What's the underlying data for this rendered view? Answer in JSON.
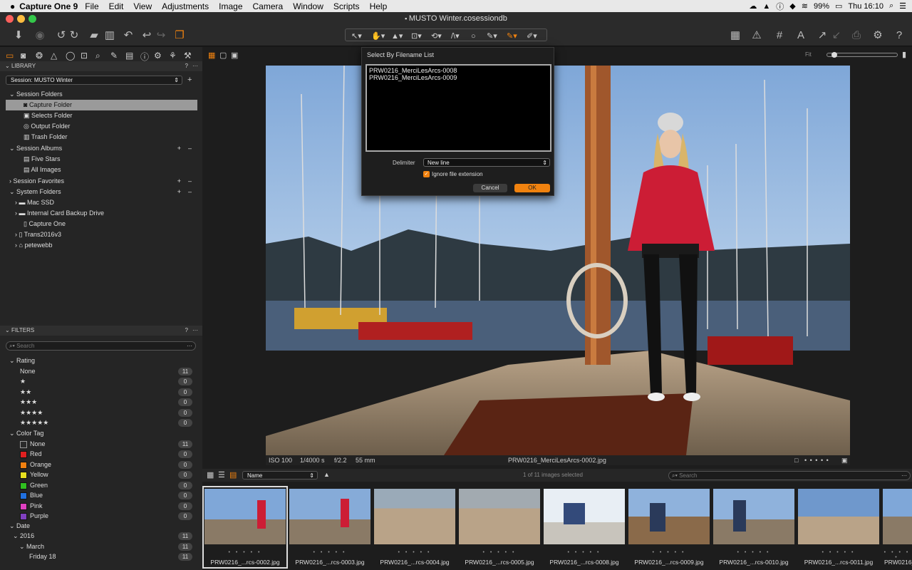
{
  "menubar": {
    "app_name": "Capture One 9",
    "items": [
      "File",
      "Edit",
      "View",
      "Adjustments",
      "Image",
      "Camera",
      "Window",
      "Scripts",
      "Help"
    ],
    "battery": "99%",
    "clock": "Thu 16:10"
  },
  "window": {
    "title": "MUSTO Winter.cosessiondb"
  },
  "library": {
    "header": "LIBRARY",
    "session_label": "Session: MUSTO Winter",
    "session_folders_label": "Session Folders",
    "session_folders": [
      "Capture Folder",
      "Selects Folder",
      "Output Folder",
      "Trash Folder"
    ],
    "session_albums_label": "Session Albums",
    "session_albums": [
      "Five Stars",
      "All Images"
    ],
    "session_favorites_label": "Session Favorites",
    "system_folders_label": "System Folders",
    "system_folders": [
      "Mac SSD",
      "Internal Card Backup Drive",
      "Capture One",
      "Trans2016v3",
      "petewebb"
    ]
  },
  "filters": {
    "header": "FILTERS",
    "search_placeholder": "Search",
    "rating_label": "Rating",
    "ratings": [
      {
        "label": "None",
        "count": "11"
      },
      {
        "label": "★",
        "count": "0"
      },
      {
        "label": "★★",
        "count": "0"
      },
      {
        "label": "★★★",
        "count": "0"
      },
      {
        "label": "★★★★",
        "count": "0"
      },
      {
        "label": "★★★★★",
        "count": "0"
      }
    ],
    "color_tag_label": "Color Tag",
    "color_tags": [
      {
        "label": "None",
        "count": "11",
        "color": "#3a3a3a"
      },
      {
        "label": "Red",
        "count": "0",
        "color": "#e02020"
      },
      {
        "label": "Orange",
        "count": "0",
        "color": "#f08010"
      },
      {
        "label": "Yellow",
        "count": "0",
        "color": "#e8e020"
      },
      {
        "label": "Green",
        "count": "0",
        "color": "#30c020"
      },
      {
        "label": "Blue",
        "count": "0",
        "color": "#2070e0"
      },
      {
        "label": "Pink",
        "count": "0",
        "color": "#e040c0"
      },
      {
        "label": "Purple",
        "count": "0",
        "color": "#8040c0"
      }
    ],
    "date_label": "Date",
    "date_rows": [
      {
        "label": "2016",
        "count": "11"
      },
      {
        "label": "March",
        "count": "11"
      },
      {
        "label": "Friday 18",
        "count": "11"
      }
    ]
  },
  "viewer": {
    "iso": "ISO 100",
    "shutter": "1/4000 s",
    "aperture": "f/2.2",
    "focal": "55 mm",
    "filename": "PRW0216_MerciLesArcs-0002.jpg",
    "fit_label": "Fit"
  },
  "browser": {
    "sort_label": "Name",
    "selection_status": "1 of 11 images selected",
    "search_placeholder": "Search",
    "thumbnails": [
      "PRW0216_...rcs-0002.jpg",
      "PRW0216_...rcs-0003.jpg",
      "PRW0216_...rcs-0004.jpg",
      "PRW0216_...rcs-0005.jpg",
      "PRW0216_...rcs-0008.jpg",
      "PRW0216_...rcs-0009.jpg",
      "PRW0216_...rcs-0010.jpg",
      "PRW0216_...rcs-0011.jpg",
      "PRW0216_"
    ],
    "stars": "• • • • •"
  },
  "dialog": {
    "title": "Select By Filename List",
    "list_text": "PRW0216_MerciLesArcs-0008\nPRW0216_MerciLesArcs-0009",
    "delimiter_label": "Delimiter",
    "delimiter_value": "New line",
    "ignore_ext_label": "Ignore file extension",
    "ignore_ext_checked": true,
    "cancel_label": "Cancel",
    "ok_label": "OK"
  },
  "colors": {
    "accent": "#f0820f",
    "panel": "#252525",
    "dialog_bg": "#1e1e1e"
  }
}
